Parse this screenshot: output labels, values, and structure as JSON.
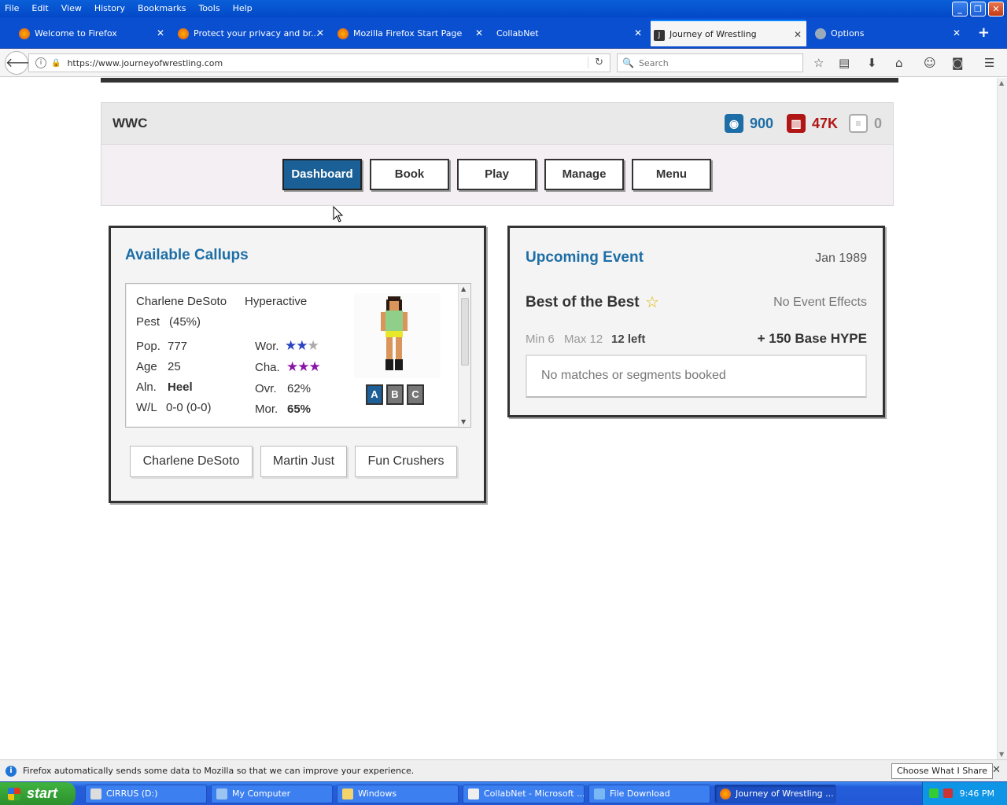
{
  "menu": [
    "File",
    "Edit",
    "View",
    "History",
    "Bookmarks",
    "Tools",
    "Help"
  ],
  "tabs": [
    {
      "label": "Welcome to Firefox",
      "icon": "firefox-icon"
    },
    {
      "label": "Protect your privacy and br...",
      "icon": "firefox-icon"
    },
    {
      "label": "Mozilla Firefox Start Page",
      "icon": "firefox-icon"
    },
    {
      "label": "CollabNet",
      "icon": "none"
    },
    {
      "label": "Journey of Wrestling",
      "icon": "journey-favicon"
    },
    {
      "label": "Options",
      "icon": "gear-icon"
    }
  ],
  "address": {
    "url": "https://www.journeyofwrestling.com",
    "search_placeholder": "Search"
  },
  "header": {
    "promotion": "WWC",
    "currency": "900",
    "cash": "47K",
    "messages": "0"
  },
  "nav": {
    "dashboard": "Dashboard",
    "book": "Book",
    "play": "Play",
    "manage": "Manage",
    "menu": "Menu"
  },
  "callups": {
    "title": "Available Callups",
    "wrestler": {
      "name": "Charlene DeSoto",
      "trait1": "Hyperactive",
      "trait2": "Pest",
      "trait_pct": "(45%)",
      "pop_label": "Pop.",
      "pop": "777",
      "age_label": "Age",
      "age": "25",
      "aln_label": "Aln.",
      "aln": "Heel",
      "wl_label": "W/L",
      "wl": "0-0 (0-0)",
      "wor_label": "Wor.",
      "wor_stars": 2,
      "cha_label": "Cha.",
      "cha_stars": 3,
      "ovr_label": "Ovr.",
      "ovr": "62%",
      "mor_label": "Mor.",
      "mor": "65%",
      "tabs": [
        "A",
        "B",
        "C"
      ]
    },
    "buttons": [
      "Charlene DeSoto",
      "Martin Just",
      "Fun Crushers"
    ]
  },
  "event": {
    "title": "Upcoming Event",
    "date": "Jan 1989",
    "name": "Best of the Best",
    "effects": "No Event Effects",
    "min": "Min 6",
    "max": "Max 12",
    "left": "12 left",
    "hype": "+ 150 Base HYPE",
    "empty": "No matches or segments booked"
  },
  "notification": {
    "text": "Firefox automatically sends some data to Mozilla so that we can improve your experience.",
    "button": "Choose What I Share"
  },
  "taskbar": {
    "start": "start",
    "items": [
      "CIRRUS (D:)",
      "My Computer",
      "Windows",
      "CollabNet - Microsoft ...",
      "File Download",
      "Journey of Wrestling ..."
    ],
    "clock": "9:46 PM"
  },
  "colors": {
    "accent": "#1d6ea6",
    "dashboard_bg": "#1a5f96",
    "currency": "#1d6ea6",
    "cash": "#b01616",
    "trait": "#86b826"
  }
}
